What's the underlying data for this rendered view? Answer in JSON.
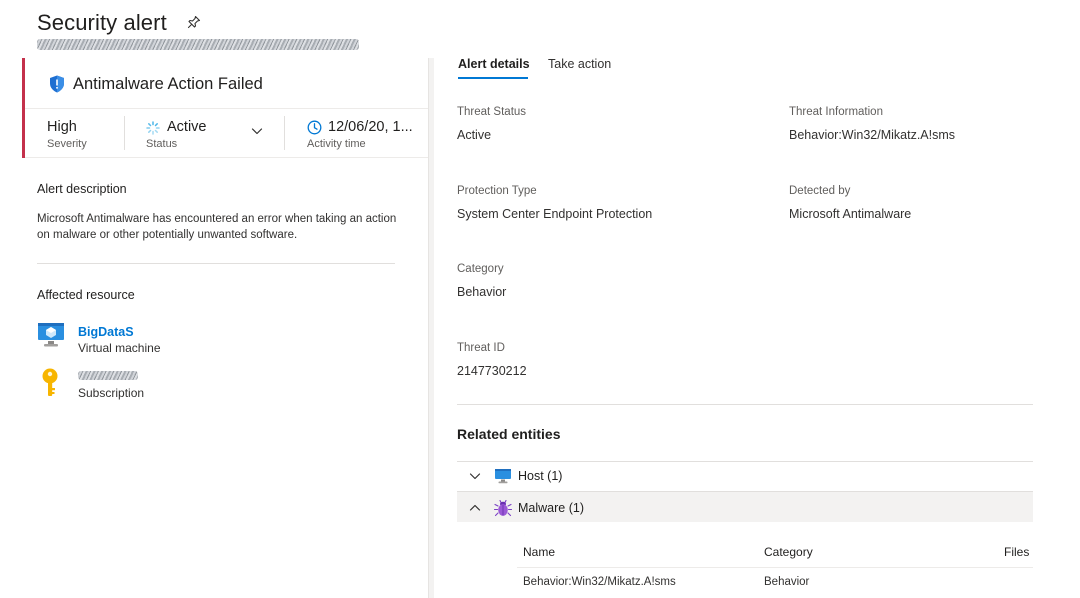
{
  "header": {
    "title": "Security alert",
    "pin_icon": "pin-icon"
  },
  "alert": {
    "name": "Antimalware Action Failed",
    "severity_value": "High",
    "severity_label": "Severity",
    "status_value": "Active",
    "status_label": "Status",
    "time_value": "12/06/20, 1...",
    "time_label": "Activity time",
    "accent_color": "#c4314b"
  },
  "description": {
    "heading": "Alert description",
    "text": "Microsoft Antimalware has encountered an error when taking an action on malware or other potentially unwanted software."
  },
  "affected": {
    "heading": "Affected resource",
    "resource_name": "BigDataS",
    "resource_type": "Virtual machine",
    "subscription_type": "Subscription"
  },
  "tabs": [
    {
      "label": "Alert details",
      "selected": true
    },
    {
      "label": "Take action",
      "selected": false
    }
  ],
  "details": {
    "threat_status_label": "Threat Status",
    "threat_status_value": "Active",
    "threat_info_label": "Threat Information",
    "threat_info_value": "Behavior:Win32/Mikatz.A!sms",
    "protection_type_label": "Protection Type",
    "protection_type_value": "System Center Endpoint Protection",
    "detected_by_label": "Detected by",
    "detected_by_value": "Microsoft Antimalware",
    "category_label": "Category",
    "category_value": "Behavior",
    "threat_id_label": "Threat ID",
    "threat_id_value": "2147730212"
  },
  "related": {
    "heading": "Related entities",
    "entities": [
      {
        "label": "Host (1)",
        "expanded": false,
        "icon": "monitor-icon"
      },
      {
        "label": "Malware (1)",
        "expanded": true,
        "icon": "bug-icon"
      }
    ],
    "table": {
      "columns": [
        "Name",
        "Category",
        "Files"
      ],
      "rows": [
        [
          "Behavior:Win32/Mikatz.A!sms",
          "Behavior",
          ""
        ]
      ]
    }
  },
  "colors": {
    "link": "#0078d4",
    "accent_red": "#c4314b"
  }
}
